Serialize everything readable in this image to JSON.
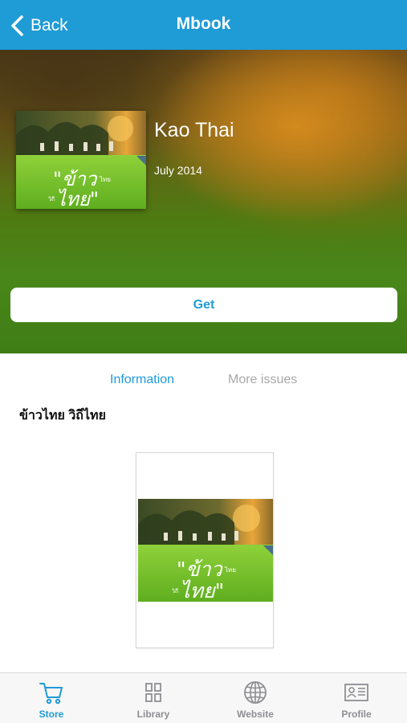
{
  "nav": {
    "back_label": "Back",
    "title": "Mbook"
  },
  "magazine": {
    "title": "Kao Thai",
    "date": "July 2014",
    "cover_text": "ข้าวไทย",
    "get_label": "Get"
  },
  "tabs": {
    "information": "Information",
    "more_issues": "More issues"
  },
  "description": "ข้าวไทย วิถีไทย",
  "tabbar": {
    "items": [
      {
        "label": "Store",
        "icon": "cart-icon",
        "active": true
      },
      {
        "label": "Library",
        "icon": "grid-icon",
        "active": false
      },
      {
        "label": "Website",
        "icon": "globe-icon",
        "active": false
      },
      {
        "label": "Profile",
        "icon": "id-card-icon",
        "active": false
      }
    ]
  },
  "colors": {
    "accent": "#1f9bd6",
    "inactive": "#8e8e93"
  }
}
